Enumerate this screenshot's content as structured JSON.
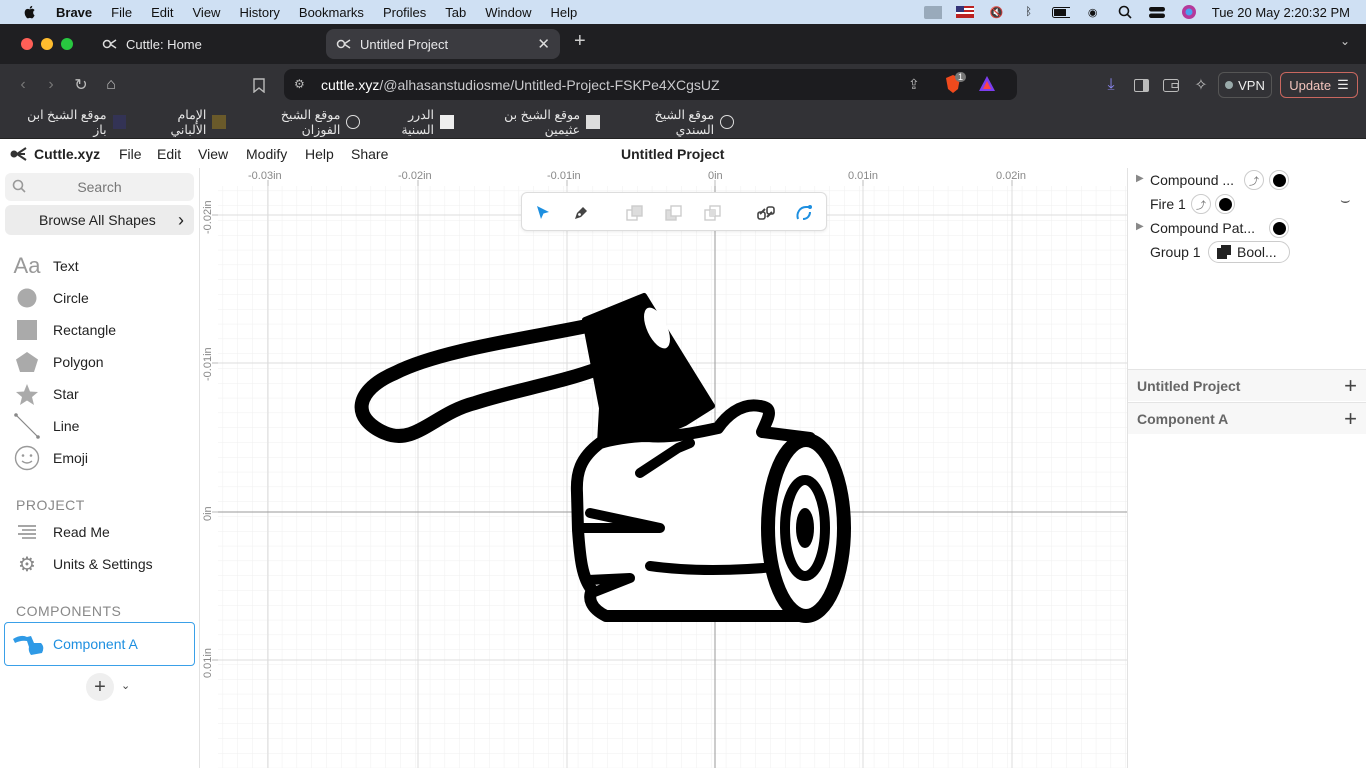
{
  "menubar": {
    "app_name": "Brave",
    "items": [
      "File",
      "Edit",
      "View",
      "History",
      "Bookmarks",
      "Profiles",
      "Tab",
      "Window",
      "Help"
    ],
    "clock": "Tue 20 May  2:20:32 PM"
  },
  "tabs": [
    {
      "label": "Cuttle: Home"
    },
    {
      "label": "Untitled Project"
    }
  ],
  "urlbar": {
    "host": "cuttle.xyz",
    "path": "/@alhasanstudiosme/Untitled-Project-FSKPe4XCgsUZ",
    "shield_count": "1"
  },
  "toolbar": {
    "vpn_label": "VPN",
    "update_label": "Update"
  },
  "bookmarks": [
    "موقع الشيخ ابن باز",
    "الإمام الألباني",
    "موقع الشيخ الفوزان",
    "الدرر السنية",
    "موقع الشيخ بن عثيمين",
    "موقع الشيخ السندي"
  ],
  "app": {
    "brand": "Cuttle.xyz",
    "menus": [
      "File",
      "Edit",
      "View",
      "Modify",
      "Help",
      "Share"
    ],
    "project_title": "Untitled Project"
  },
  "sidebar": {
    "search_placeholder": "Search",
    "browse_label": "Browse All Shapes",
    "shapes": [
      {
        "label": "Text",
        "icon": "text-icon"
      },
      {
        "label": "Circle",
        "icon": "circle-icon"
      },
      {
        "label": "Rectangle",
        "icon": "rectangle-icon"
      },
      {
        "label": "Polygon",
        "icon": "polygon-icon"
      },
      {
        "label": "Star",
        "icon": "star-icon"
      },
      {
        "label": "Line",
        "icon": "line-icon"
      },
      {
        "label": "Emoji",
        "icon": "emoji-icon"
      }
    ],
    "project_heading": "PROJECT",
    "project_items": [
      {
        "label": "Read Me",
        "icon": "read-me-icon"
      },
      {
        "label": "Units & Settings",
        "icon": "gear-icon"
      }
    ],
    "components_heading": "COMPONENTS",
    "component": "Component A"
  },
  "canvas": {
    "ruler_top": [
      "-0.03in",
      "-0.02in",
      "-0.01in",
      "0in",
      "0.01in",
      "0.02in"
    ],
    "ruler_left": [
      "-0.02in",
      "-0.01in",
      "0in",
      "0.01in"
    ]
  },
  "layers": {
    "items": [
      {
        "name": "Compound ...",
        "expandable": true
      },
      {
        "name": "Fire 1",
        "expandable": false
      },
      {
        "name": "Compound Pat...",
        "expandable": true
      },
      {
        "name": "Group 1",
        "expandable": false
      }
    ],
    "bool_label": "Bool..."
  },
  "panels": {
    "untitled_project": "Untitled Project",
    "component_a": "Component A"
  },
  "colors": {
    "accent": "#1d8fe0",
    "canvas_grid": "#ececec"
  }
}
